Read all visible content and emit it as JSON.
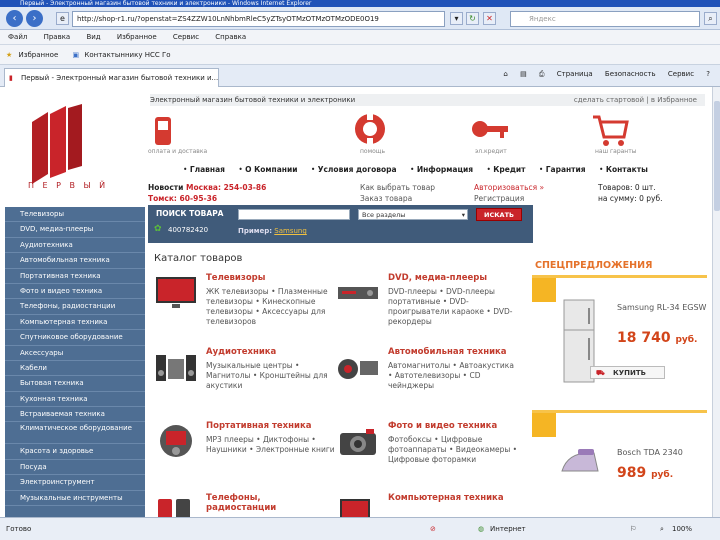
{
  "browser": {
    "window_title": "Первый - Электронный магазин бытовой техники и электроники - Windows Internet Explorer",
    "url": "http://shop-r1.ru/?openstat=ZS4ZZW10LnNhbmRleC5yZTsyOTMzOTMzOTMzODE0O19",
    "search_placeholder": "Яндекс",
    "menu": [
      "Файл",
      "Правка",
      "Вид",
      "Избранное",
      "Сервис",
      "Справка"
    ],
    "favorites_label": "Избранное",
    "favorite_link": "Контактыннику НСС Го",
    "tab_title": "Первый - Электронный магазин бытовой техники и...",
    "toolbar": [
      "Страница",
      "Безопасность",
      "Сервис"
    ],
    "status_left": "Готово",
    "status_zone": "Интернет",
    "zoom": "100%"
  },
  "site": {
    "logo_text": "П Е Р В Ы Й",
    "tagline": "Электронный магазин бытовой техники и электроники",
    "top_links": [
      "сделать стартовой",
      "в Избранное"
    ],
    "subnav": [
      "оплата и доставка",
      "помощь",
      "эл.кредит",
      "наш гаранты"
    ],
    "nav": [
      "Главная",
      "О Компании",
      "Условия договора",
      "Информация",
      "Кредит",
      "Гарантия",
      "Контакты"
    ],
    "news": "Новости",
    "phones": [
      "Москва: 254-03-86",
      "Томск: 60-95-36"
    ],
    "links_mid": [
      "Как выбрать товар",
      "Заказ товара"
    ],
    "auth": "Авторизоваться »",
    "auth2": "Регистрация",
    "cart": "Товаров: 0 шт.",
    "cart2": "на сумму: 0 руб.",
    "icq": "400782420",
    "search_label": "ПОИСК ТОВАРА",
    "search_select": "Все разделы",
    "search_btn": "ИСКАТЬ",
    "example_label": "Пример:",
    "example_value": "Samsung"
  },
  "sidebar": [
    "Телевизоры",
    "DVD, медиа-плееры",
    "Аудиотехника",
    "Автомобильная техника",
    "Портативная техника",
    "Фото и видео техника",
    "Телефоны, радиостанции",
    "Компьютерная техника",
    "Спутниковое оборудование",
    "Аксессуары",
    "Кабели",
    "Бытовая техника",
    "Кухонная техника",
    "Встраиваемая техника",
    "Климатическое оборудование",
    "Красота и здоровье",
    "Посуда",
    "Электроинструмент",
    "Музыкальные инструменты"
  ],
  "catalog": {
    "title": "Каталог товаров",
    "items": [
      {
        "title": "Телевизоры",
        "desc": "ЖК телевизоры • Плазменные телевизоры • Кинескопные телевизоры • Аксессуары для телевизоров"
      },
      {
        "title": "DVD, медиа-плееры",
        "desc": "DVD-плееры • DVD-плееры портативные • DVD-проигрыватели караоке • DVD-рекордеры"
      },
      {
        "title": "Аудиотехника",
        "desc": "Музыкальные центры • Магнитолы • Кронштейны для акустики"
      },
      {
        "title": "Автомобильная техника",
        "desc": "Автомагнитолы • Автоакустика • Автотелевизоры • CD чейнджеры"
      },
      {
        "title": "Портативная техника",
        "desc": "MP3 плееры • Диктофоны • Наушники • Электронные книги"
      },
      {
        "title": "Фото и видео техника",
        "desc": "Фотобоксы • Цифровые фотоаппараты • Видеокамеры • Цифровые фоторамки"
      },
      {
        "title": "Телефоны, радиостанции",
        "desc": ""
      },
      {
        "title": "Компьютерная техника",
        "desc": ""
      }
    ]
  },
  "promo": {
    "title": "СПЕЦПРЕДЛОЖЕНИЯ",
    "items": [
      {
        "name": "Samsung RL-34 EGSW",
        "price": "18 740",
        "unit": "руб.",
        "buy": "КУПИТЬ"
      },
      {
        "name": "Bosch TDA 2340",
        "price": "989",
        "unit": "руб."
      }
    ]
  },
  "colors": {
    "accent": "#c9242a",
    "sidebar": "#4e6e93",
    "promo": "#e5722a"
  }
}
